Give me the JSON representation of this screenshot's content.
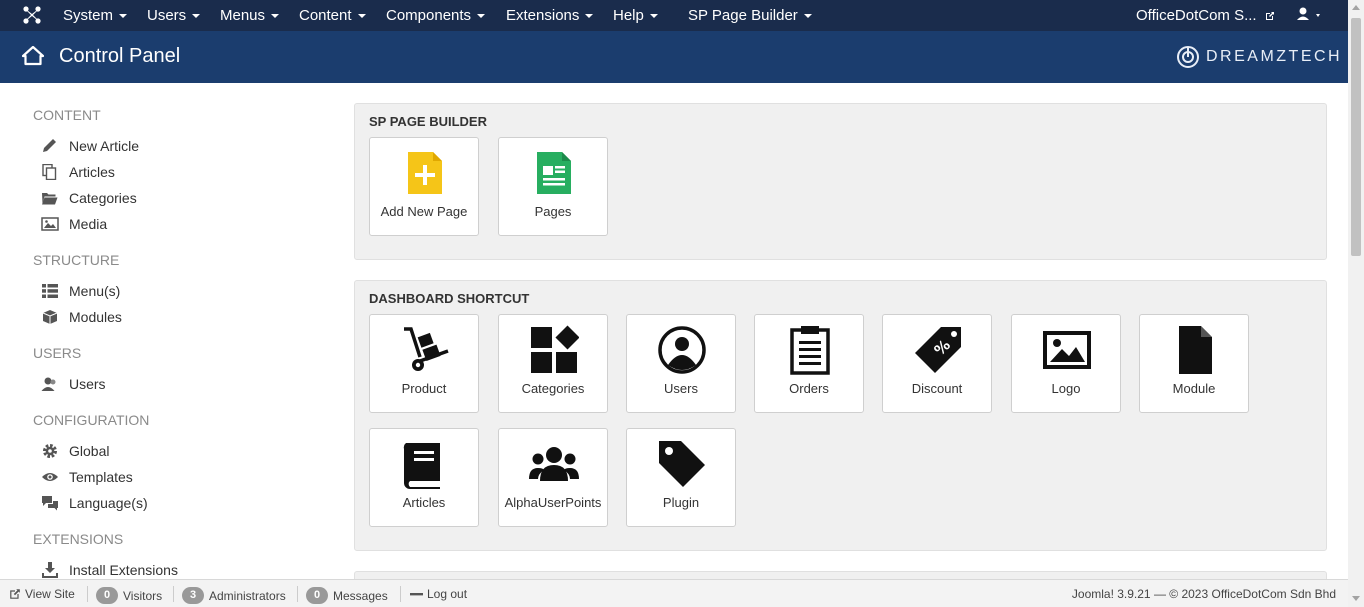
{
  "topnav": {
    "menus": [
      "System",
      "Users",
      "Menus",
      "Content",
      "Components",
      "Extensions",
      "Help",
      "SP Page Builder"
    ],
    "site_name": "OfficeDotCom S..."
  },
  "header": {
    "title": "Control Panel",
    "brand": "DREAMZTECH"
  },
  "sidebar": {
    "content_heading": "CONTENT",
    "new_article": "New Article",
    "articles": "Articles",
    "categories": "Categories",
    "media": "Media",
    "structure_heading": "STRUCTURE",
    "menus": "Menu(s)",
    "modules": "Modules",
    "users_heading": "USERS",
    "users": "Users",
    "configuration_heading": "CONFIGURATION",
    "global": "Global",
    "templates": "Templates",
    "languages": "Language(s)",
    "extensions_heading": "EXTENSIONS",
    "install_extensions": "Install Extensions"
  },
  "sp_page_builder": {
    "heading": "SP PAGE BUILDER",
    "tiles": [
      "Add New Page",
      "Pages"
    ]
  },
  "dashboard": {
    "heading": "DASHBOARD SHORTCUT",
    "tiles": [
      "Product",
      "Categories",
      "Users",
      "Orders",
      "Discount",
      "Logo",
      "Module",
      "Articles",
      "AlphaUserPoints",
      "Plugin"
    ]
  },
  "statusbar": {
    "view_site": "View Site",
    "visitors_count": "0",
    "visitors": "Visitors",
    "admins_count": "3",
    "admins": "Administrators",
    "messages_count": "0",
    "messages": "Messages",
    "logout": "Log out",
    "version": "Joomla! 3.9.21",
    "copyright": "— © 2023 OfficeDotCom Sdn Bhd"
  },
  "colors": {
    "topnav": "#1a2c4c",
    "header": "#1b3d6e",
    "add_page_yellow": "#f5c518",
    "pages_green": "#27ae60"
  }
}
